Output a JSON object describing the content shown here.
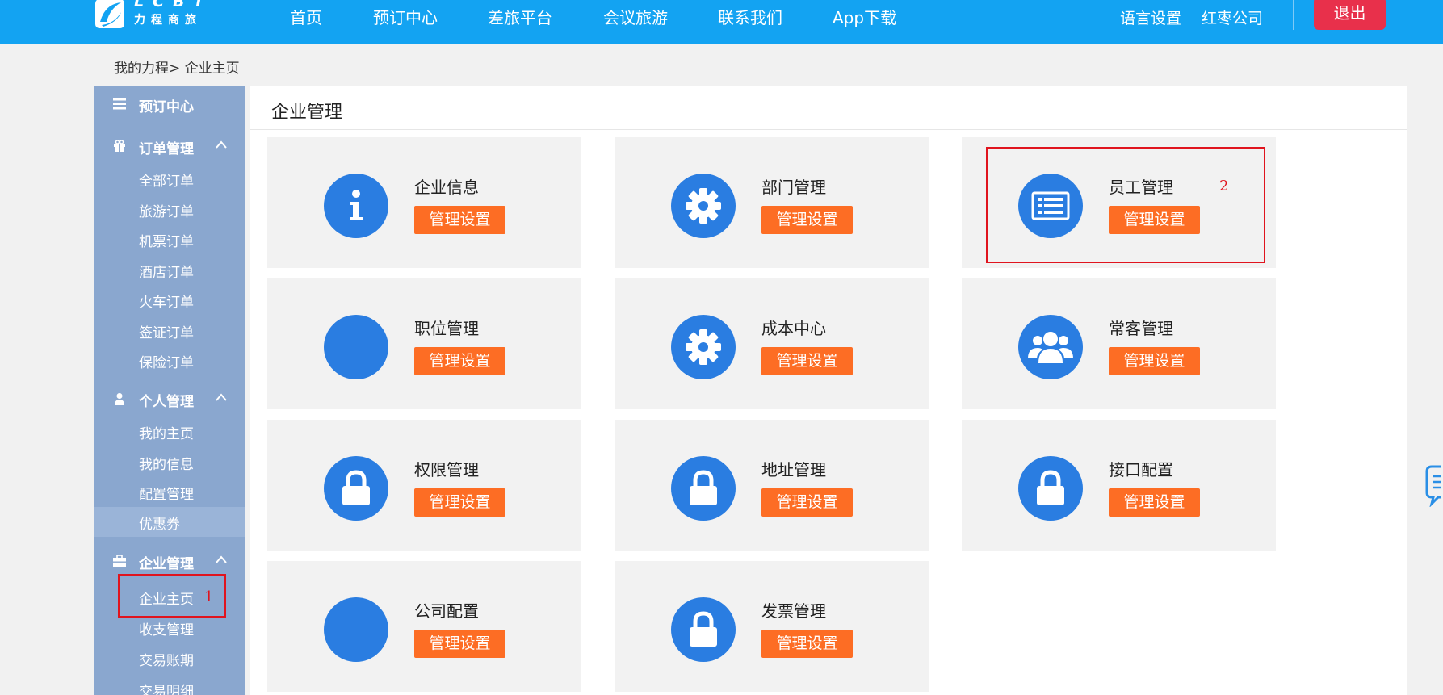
{
  "colors": {
    "topbar": "#13a3f2",
    "sidebar": "#8aa7cf",
    "icon_circle": "#2a7de1",
    "action_button": "#fd6d24",
    "logout_button": "#e8304b",
    "annotation": "#e0141e"
  },
  "header": {
    "logo_en": "LCBT",
    "logo_cn": "力程商旅",
    "nav": [
      "首页",
      "预订中心",
      "差旅平台",
      "会议旅游",
      "联系我们",
      "App下载"
    ],
    "language": "语言设置",
    "company": "红枣公司",
    "logout": "退出"
  },
  "breadcrumb": "我的力程> 企业主页",
  "sidebar": {
    "booking": "预订中心",
    "orders": {
      "title": "订单管理",
      "items": [
        "全部订单",
        "旅游订单",
        "机票订单",
        "酒店订单",
        "火车订单",
        "签证订单",
        "保险订单"
      ]
    },
    "personal": {
      "title": "个人管理",
      "items": [
        "我的主页",
        "我的信息",
        "配置管理",
        "优惠券"
      ]
    },
    "enterprise": {
      "title": "企业管理",
      "items": [
        "企业主页",
        "收支管理",
        "交易账期",
        "交易明细"
      ]
    }
  },
  "main": {
    "title": "企业管理",
    "cards": [
      {
        "title": "企业信息",
        "button": "管理设置",
        "icon": "info-icon"
      },
      {
        "title": "部门管理",
        "button": "管理设置",
        "icon": "gear-icon"
      },
      {
        "title": "员工管理",
        "button": "管理设置",
        "icon": "list-icon"
      },
      {
        "title": "职位管理",
        "button": "管理设置",
        "icon": "blank-icon"
      },
      {
        "title": "成本中心",
        "button": "管理设置",
        "icon": "gear-icon"
      },
      {
        "title": "常客管理",
        "button": "管理设置",
        "icon": "users-icon"
      },
      {
        "title": "权限管理",
        "button": "管理设置",
        "icon": "lock-icon"
      },
      {
        "title": "地址管理",
        "button": "管理设置",
        "icon": "lock-icon"
      },
      {
        "title": "接口配置",
        "button": "管理设置",
        "icon": "lock-icon"
      },
      {
        "title": "公司配置",
        "button": "管理设置",
        "icon": "blank-icon"
      },
      {
        "title": "发票管理",
        "button": "管理设置",
        "icon": "lock-icon"
      }
    ]
  },
  "annotations": [
    "1",
    "2"
  ]
}
